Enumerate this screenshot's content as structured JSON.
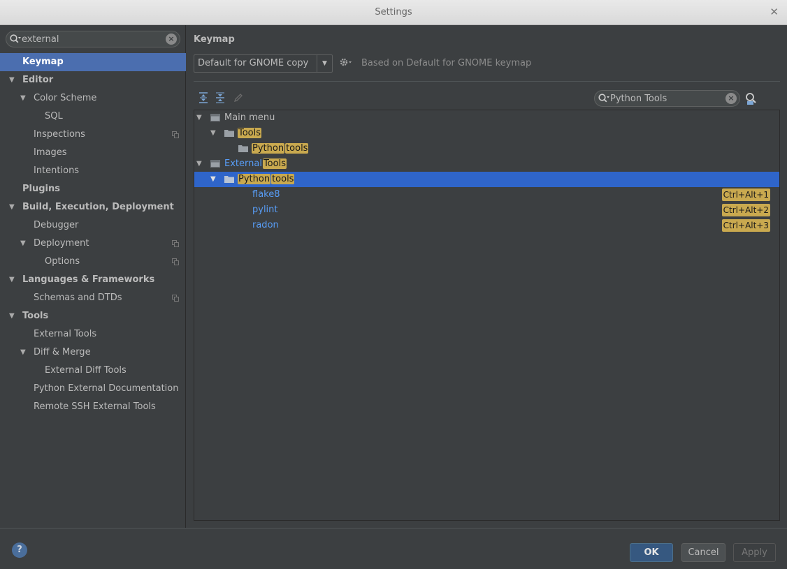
{
  "window": {
    "title": "Settings",
    "close_glyph": "✕"
  },
  "sidebar": {
    "search": {
      "value": "external"
    },
    "items": [
      {
        "label": "Keymap"
      },
      {
        "label": "Editor"
      },
      {
        "label": "Color Scheme"
      },
      {
        "label": "SQL"
      },
      {
        "label": "Inspections"
      },
      {
        "label": "Images"
      },
      {
        "label": "Intentions"
      },
      {
        "label": "Plugins"
      },
      {
        "label": "Build, Execution, Deployment"
      },
      {
        "label": "Debugger"
      },
      {
        "label": "Deployment"
      },
      {
        "label": "Options"
      },
      {
        "label": "Languages & Frameworks"
      },
      {
        "label": "Schemas and DTDs"
      },
      {
        "label": "Tools"
      },
      {
        "label": "External Tools"
      },
      {
        "label": "Diff & Merge"
      },
      {
        "label": "External Diff Tools"
      },
      {
        "label": "Python External Documentation"
      },
      {
        "label": "Remote SSH External Tools"
      }
    ]
  },
  "keymap": {
    "title": "Keymap",
    "selected_keymap": "Default for GNOME copy",
    "based_on": "Based on Default for GNOME keymap",
    "search": {
      "value": "Python Tools"
    },
    "tree": {
      "main_menu": "Main menu",
      "tools": "Tools",
      "python": "Python",
      "tools_lower": "tools",
      "external": "External",
      "external_tools_hl": "Tools",
      "actions": [
        {
          "label": "flake8",
          "shortcut": "Ctrl+Alt+1"
        },
        {
          "label": "pylint",
          "shortcut": "Ctrl+Alt+2"
        },
        {
          "label": "radon",
          "shortcut": "Ctrl+Alt+3"
        }
      ]
    }
  },
  "footer": {
    "help": "?",
    "ok": "OK",
    "cancel": "Cancel",
    "apply": "Apply"
  },
  "colors": {
    "background": "#3c3f41",
    "selection_sidebar": "#4b6eaf",
    "selection_tree": "#2f65ca",
    "highlight": "#c9a94f",
    "link": "#589df6"
  }
}
